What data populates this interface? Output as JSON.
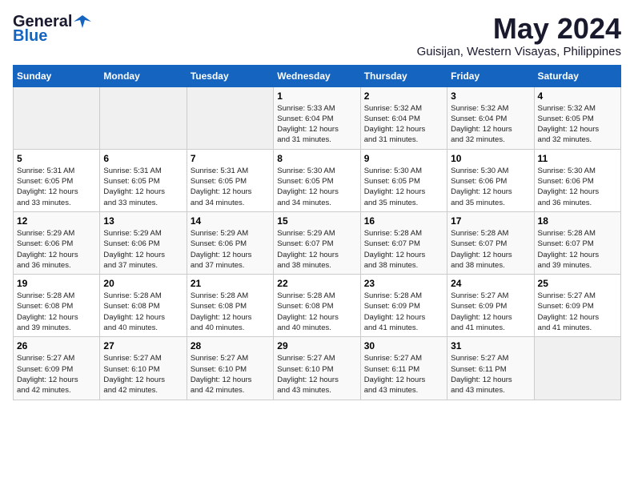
{
  "logo": {
    "general": "General",
    "blue": "Blue"
  },
  "title": "May 2024",
  "location": "Guisijan, Western Visayas, Philippines",
  "weekdays": [
    "Sunday",
    "Monday",
    "Tuesday",
    "Wednesday",
    "Thursday",
    "Friday",
    "Saturday"
  ],
  "weeks": [
    [
      {
        "day": "",
        "info": ""
      },
      {
        "day": "",
        "info": ""
      },
      {
        "day": "",
        "info": ""
      },
      {
        "day": "1",
        "info": "Sunrise: 5:33 AM\nSunset: 6:04 PM\nDaylight: 12 hours\nand 31 minutes."
      },
      {
        "day": "2",
        "info": "Sunrise: 5:32 AM\nSunset: 6:04 PM\nDaylight: 12 hours\nand 31 minutes."
      },
      {
        "day": "3",
        "info": "Sunrise: 5:32 AM\nSunset: 6:04 PM\nDaylight: 12 hours\nand 32 minutes."
      },
      {
        "day": "4",
        "info": "Sunrise: 5:32 AM\nSunset: 6:05 PM\nDaylight: 12 hours\nand 32 minutes."
      }
    ],
    [
      {
        "day": "5",
        "info": "Sunrise: 5:31 AM\nSunset: 6:05 PM\nDaylight: 12 hours\nand 33 minutes."
      },
      {
        "day": "6",
        "info": "Sunrise: 5:31 AM\nSunset: 6:05 PM\nDaylight: 12 hours\nand 33 minutes."
      },
      {
        "day": "7",
        "info": "Sunrise: 5:31 AM\nSunset: 6:05 PM\nDaylight: 12 hours\nand 34 minutes."
      },
      {
        "day": "8",
        "info": "Sunrise: 5:30 AM\nSunset: 6:05 PM\nDaylight: 12 hours\nand 34 minutes."
      },
      {
        "day": "9",
        "info": "Sunrise: 5:30 AM\nSunset: 6:05 PM\nDaylight: 12 hours\nand 35 minutes."
      },
      {
        "day": "10",
        "info": "Sunrise: 5:30 AM\nSunset: 6:06 PM\nDaylight: 12 hours\nand 35 minutes."
      },
      {
        "day": "11",
        "info": "Sunrise: 5:30 AM\nSunset: 6:06 PM\nDaylight: 12 hours\nand 36 minutes."
      }
    ],
    [
      {
        "day": "12",
        "info": "Sunrise: 5:29 AM\nSunset: 6:06 PM\nDaylight: 12 hours\nand 36 minutes."
      },
      {
        "day": "13",
        "info": "Sunrise: 5:29 AM\nSunset: 6:06 PM\nDaylight: 12 hours\nand 37 minutes."
      },
      {
        "day": "14",
        "info": "Sunrise: 5:29 AM\nSunset: 6:06 PM\nDaylight: 12 hours\nand 37 minutes."
      },
      {
        "day": "15",
        "info": "Sunrise: 5:29 AM\nSunset: 6:07 PM\nDaylight: 12 hours\nand 38 minutes."
      },
      {
        "day": "16",
        "info": "Sunrise: 5:28 AM\nSunset: 6:07 PM\nDaylight: 12 hours\nand 38 minutes."
      },
      {
        "day": "17",
        "info": "Sunrise: 5:28 AM\nSunset: 6:07 PM\nDaylight: 12 hours\nand 38 minutes."
      },
      {
        "day": "18",
        "info": "Sunrise: 5:28 AM\nSunset: 6:07 PM\nDaylight: 12 hours\nand 39 minutes."
      }
    ],
    [
      {
        "day": "19",
        "info": "Sunrise: 5:28 AM\nSunset: 6:08 PM\nDaylight: 12 hours\nand 39 minutes."
      },
      {
        "day": "20",
        "info": "Sunrise: 5:28 AM\nSunset: 6:08 PM\nDaylight: 12 hours\nand 40 minutes."
      },
      {
        "day": "21",
        "info": "Sunrise: 5:28 AM\nSunset: 6:08 PM\nDaylight: 12 hours\nand 40 minutes."
      },
      {
        "day": "22",
        "info": "Sunrise: 5:28 AM\nSunset: 6:08 PM\nDaylight: 12 hours\nand 40 minutes."
      },
      {
        "day": "23",
        "info": "Sunrise: 5:28 AM\nSunset: 6:09 PM\nDaylight: 12 hours\nand 41 minutes."
      },
      {
        "day": "24",
        "info": "Sunrise: 5:27 AM\nSunset: 6:09 PM\nDaylight: 12 hours\nand 41 minutes."
      },
      {
        "day": "25",
        "info": "Sunrise: 5:27 AM\nSunset: 6:09 PM\nDaylight: 12 hours\nand 41 minutes."
      }
    ],
    [
      {
        "day": "26",
        "info": "Sunrise: 5:27 AM\nSunset: 6:09 PM\nDaylight: 12 hours\nand 42 minutes."
      },
      {
        "day": "27",
        "info": "Sunrise: 5:27 AM\nSunset: 6:10 PM\nDaylight: 12 hours\nand 42 minutes."
      },
      {
        "day": "28",
        "info": "Sunrise: 5:27 AM\nSunset: 6:10 PM\nDaylight: 12 hours\nand 42 minutes."
      },
      {
        "day": "29",
        "info": "Sunrise: 5:27 AM\nSunset: 6:10 PM\nDaylight: 12 hours\nand 43 minutes."
      },
      {
        "day": "30",
        "info": "Sunrise: 5:27 AM\nSunset: 6:11 PM\nDaylight: 12 hours\nand 43 minutes."
      },
      {
        "day": "31",
        "info": "Sunrise: 5:27 AM\nSunset: 6:11 PM\nDaylight: 12 hours\nand 43 minutes."
      },
      {
        "day": "",
        "info": ""
      }
    ]
  ]
}
